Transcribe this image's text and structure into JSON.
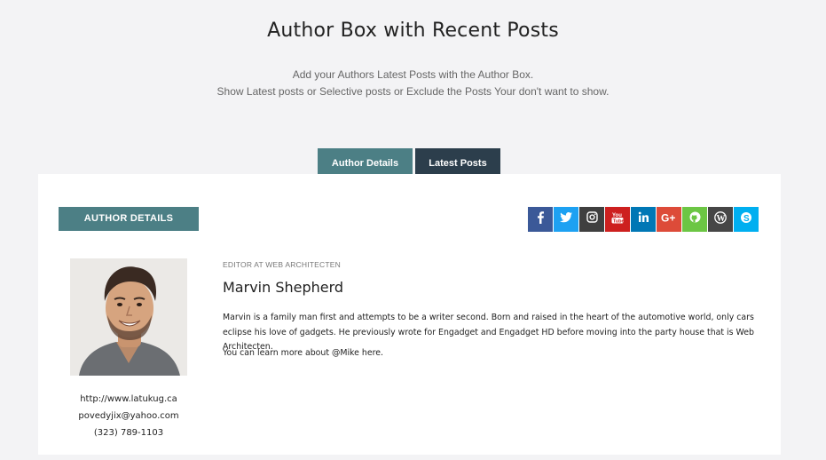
{
  "header": {
    "title": "Author Box with Recent Posts",
    "subtitle_line1": "Add your Authors Latest Posts with the Author Box.",
    "subtitle_line2": "Show Latest posts or Selective posts or Exclude the Posts Your don't want to show."
  },
  "tabs": [
    {
      "label": "Author Details",
      "active": true
    },
    {
      "label": "Latest Posts",
      "active": false
    }
  ],
  "section_label": "AUTHOR DETAILS",
  "social": [
    {
      "icon": "facebook-icon",
      "glyph": "f",
      "color": "#3b5998"
    },
    {
      "icon": "twitter-icon",
      "glyph": "t",
      "color": "#1da1f2"
    },
    {
      "icon": "instagram-icon",
      "glyph": "ig",
      "color": "#3f3f3f"
    },
    {
      "icon": "youtube-icon",
      "glyph": "yt",
      "color": "#cd201f"
    },
    {
      "icon": "linkedin-icon",
      "glyph": "in",
      "color": "#0077b5"
    },
    {
      "icon": "google-plus-icon",
      "glyph": "G+",
      "color": "#dd4b39"
    },
    {
      "icon": "github-icon",
      "glyph": "gh",
      "color": "#6cc644"
    },
    {
      "icon": "wordpress-icon",
      "glyph": "W",
      "color": "#464646"
    },
    {
      "icon": "skype-icon",
      "glyph": "S",
      "color": "#00aff0"
    }
  ],
  "author": {
    "role": "EDITOR AT WEB ARCHITECTEN",
    "name": "Marvin Shepherd",
    "bio": "Marvin is a family man first and attempts to be a writer second. Born and raised in the heart of the automotive world, only cars eclipse his love of gadgets. He previously wrote for Engadget and Engadget HD before moving into the party house that is Web Architecten.",
    "more": "You can learn more about @Mike here.",
    "website": "http://www.latukug.ca",
    "email": "povedyjix@yahoo.com",
    "phone": "(323) 789-1103"
  }
}
